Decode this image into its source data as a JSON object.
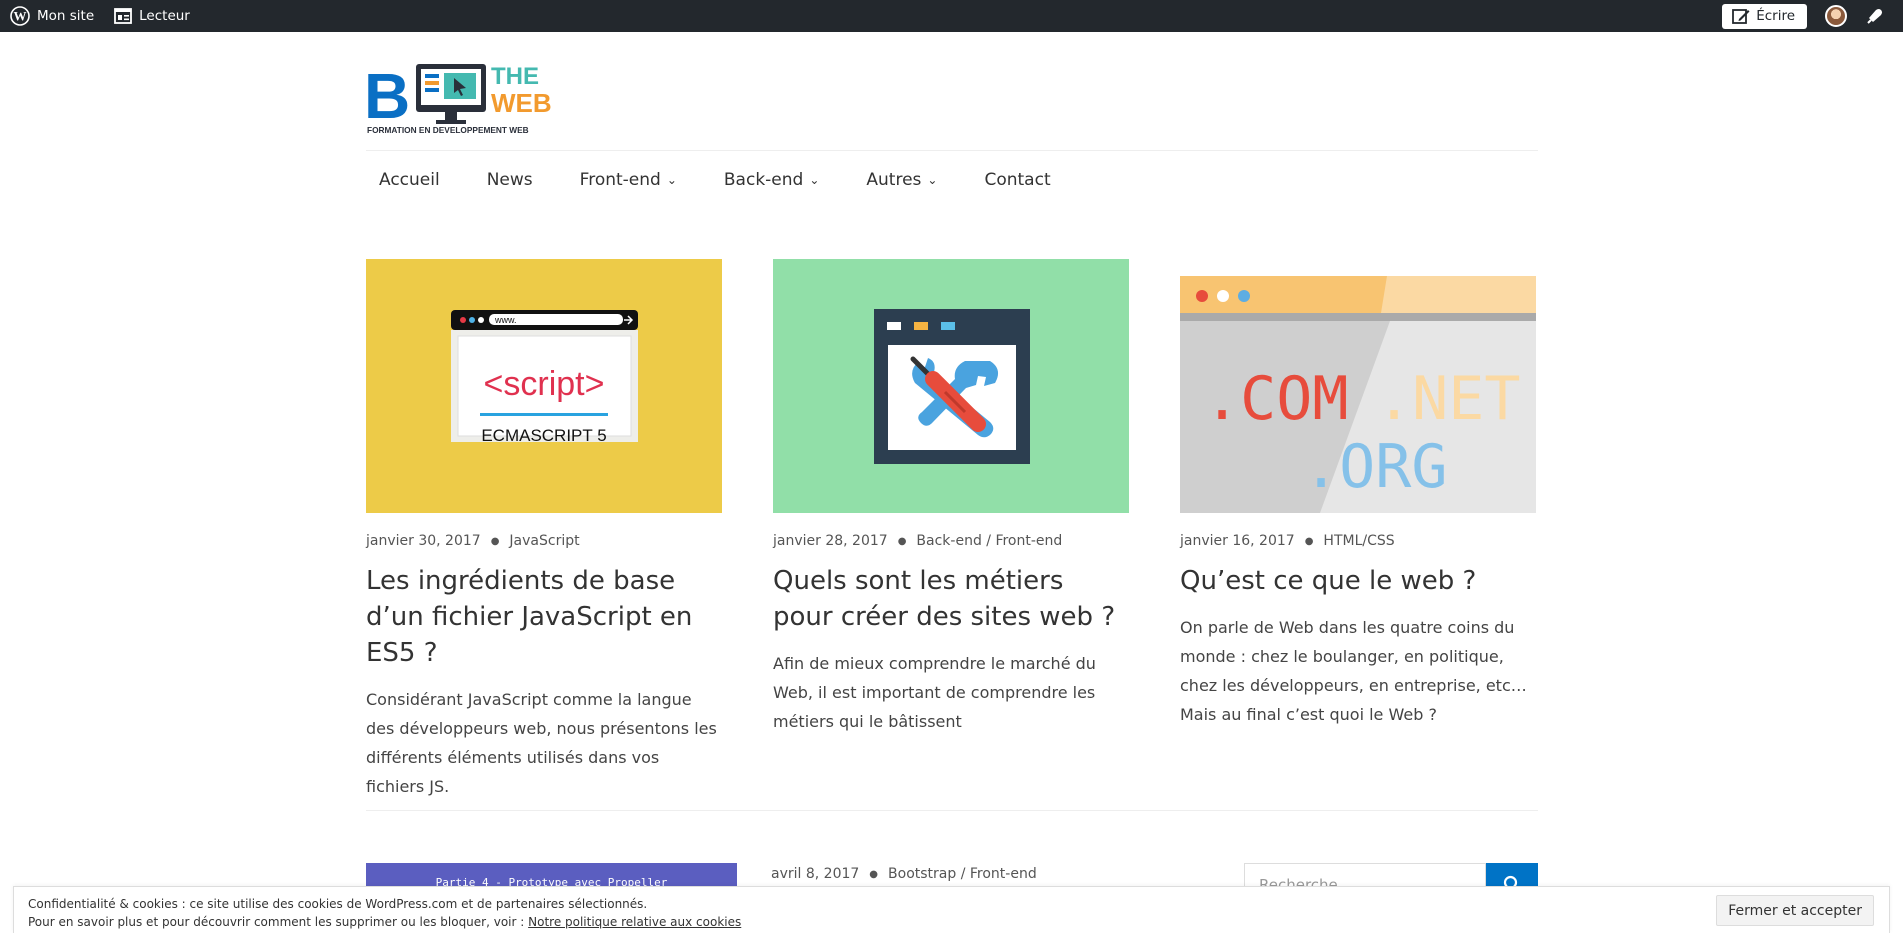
{
  "adminbar": {
    "site_label": "Mon site",
    "reader_label": "Lecteur",
    "write_label": "Écrire"
  },
  "logo": {
    "letter": "B",
    "line1": "THE",
    "line2": "WEB",
    "tagline": "FORMATION EN DEVELOPPEMENT WEB"
  },
  "nav": {
    "items": [
      {
        "label": "Accueil"
      },
      {
        "label": "News"
      },
      {
        "label": "Front-end"
      },
      {
        "label": "Back-end"
      },
      {
        "label": "Autres"
      },
      {
        "label": "Contact"
      }
    ]
  },
  "posts": [
    {
      "date": "janvier 30, 2017",
      "category": "JavaScript",
      "title": "Les ingrédients de base d’un fichier JavaScript en ES5 ?",
      "excerpt": "Considérant JavaScript comme la langue des développeurs web, nous présentons les différents éléments utilisés dans vos fichiers JS.",
      "thumb_bg": "#edcb48",
      "thumb": {
        "url": "www.",
        "code": "<script>",
        "caption": "ECMASCRIPT 5"
      }
    },
    {
      "date": "janvier 28, 2017",
      "category": "Back-end / Front-end",
      "title": "Quels sont les métiers pour créer des sites web ?",
      "excerpt": "Afin de mieux comprendre le marché du Web, il est important de comprendre les métiers qui le bâtissent",
      "thumb_bg": "#91dfa8"
    },
    {
      "date": "janvier 16, 2017",
      "category": "HTML/CSS",
      "title": "Qu’est ce que le web ?",
      "excerpt": "On parle de Web dans les quatre coins du monde : chez le boulanger, en politique, chez les développeurs, en entreprise, etc…Mais au final c’est quoi le Web ?",
      "thumb_bg": "#dcdcdc",
      "thumb": {
        "tld1": ".COM",
        "tld2": ".NET",
        "tld3": ".ORG"
      }
    }
  ],
  "second_row": {
    "thumb_text": "Partie 4 - Prototype avec Propeller",
    "date": "avril 8, 2017",
    "category": "Bootstrap / Front-end",
    "search_placeholder": "Recherche…"
  },
  "cookie": {
    "line1": "Confidentialité & cookies : ce site utilise des cookies de WordPress.com et de partenaires sélectionnés.",
    "line2": "Pour en savoir plus et pour découvrir comment les supprimer ou les bloquer, voir : ",
    "link": "Notre politique relative aux cookies",
    "button": "Fermer et accepter"
  },
  "colors": {
    "adminbar": "#23282d",
    "brand_blue": "#0073c6",
    "brand_orange": "#f29a2e",
    "brand_teal": "#44b9b0"
  }
}
